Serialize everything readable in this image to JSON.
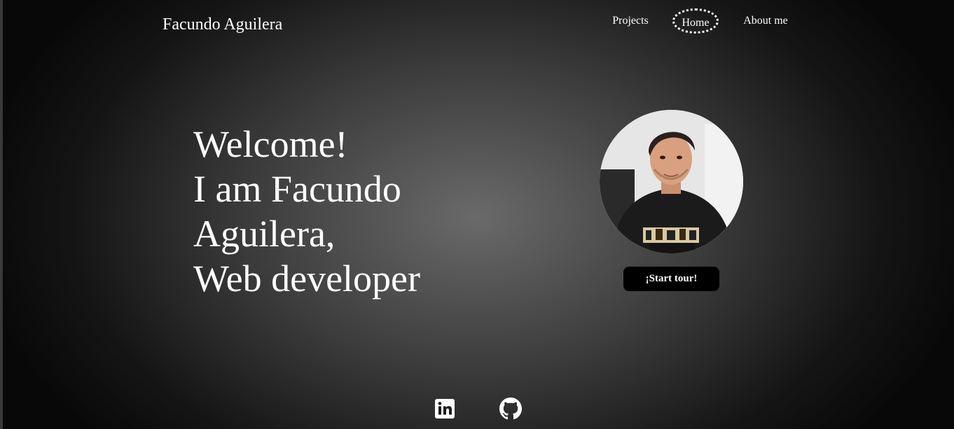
{
  "header": {
    "brand": "Facundo Aguilera",
    "nav": [
      {
        "label": "Projects",
        "active": false
      },
      {
        "label": "Home",
        "active": true
      },
      {
        "label": "About me",
        "active": false
      }
    ]
  },
  "hero": {
    "lines": [
      "Welcome!",
      "I am Facundo",
      "Aguilera,",
      "Web developer"
    ],
    "start_button": "¡Start tour!"
  },
  "social": [
    {
      "icon": "linkedin-icon"
    },
    {
      "icon": "github-icon"
    }
  ],
  "colors": {
    "text": "#ffffff",
    "button_bg": "#000000",
    "bg_center": "#6a6a6a",
    "bg_edge": "#080808"
  }
}
